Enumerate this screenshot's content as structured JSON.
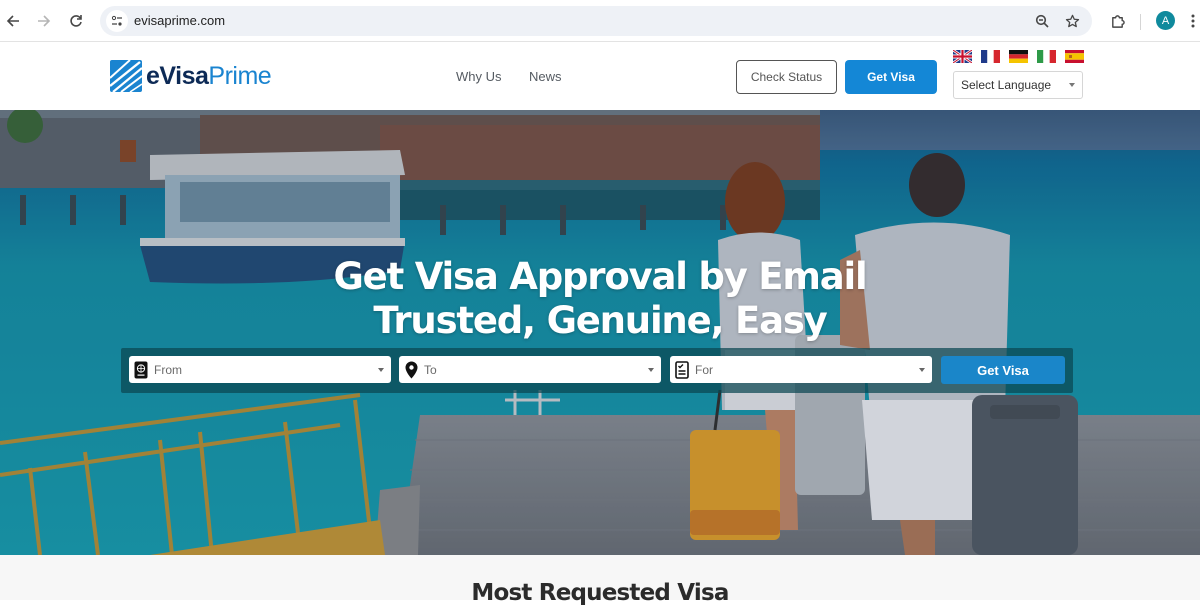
{
  "browser": {
    "url": "evisaprime.com",
    "back_icon": "arrow-left-icon",
    "forward_icon": "arrow-right-icon",
    "reload_icon": "reload-icon",
    "site_info_icon": "tune-icon",
    "zoom_icon": "magnifier-icon",
    "bookmark_icon": "star-icon",
    "extensions_icon": "puzzle-icon",
    "profile_initial": "A",
    "menu_icon": "kebab-menu-icon"
  },
  "header": {
    "logo": {
      "part1": "e",
      "part2": "Visa",
      "part3": "Prime"
    },
    "nav": [
      {
        "label": "Why Us"
      },
      {
        "label": "News"
      }
    ],
    "check_status_label": "Check Status",
    "get_visa_label": "Get Visa",
    "flags": [
      {
        "name": "English",
        "code": "gb"
      },
      {
        "name": "French",
        "code": "fr"
      },
      {
        "name": "German",
        "code": "de"
      },
      {
        "name": "Italian",
        "code": "it"
      },
      {
        "name": "Spanish",
        "code": "es"
      }
    ],
    "language_select": {
      "value": "Select Language"
    },
    "brand_color": "#1487d6"
  },
  "hero": {
    "title_line1": "Get Visa Approval by Email",
    "title_line2": "Trusted, Genuine, Easy",
    "fields": [
      {
        "label": "From",
        "icon": "passport-icon"
      },
      {
        "label": "To",
        "icon": "map-pin-icon"
      },
      {
        "label": "For",
        "icon": "checklist-icon"
      }
    ],
    "submit_label": "Get Visa"
  },
  "section": {
    "title": "Most Requested Visa"
  }
}
